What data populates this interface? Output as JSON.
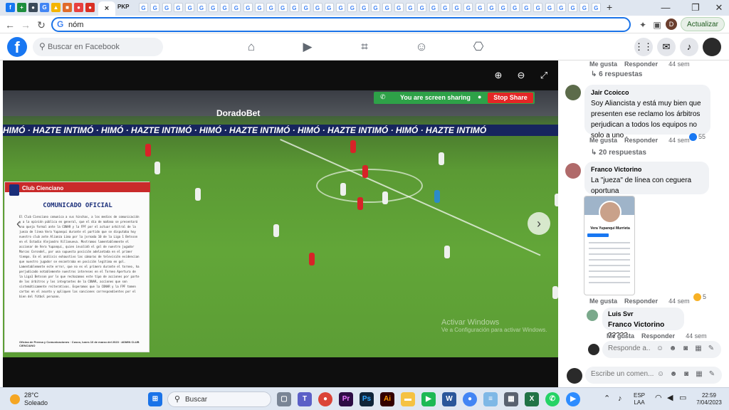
{
  "browser": {
    "tab_favicons": [
      {
        "name": "fb",
        "color": "#1877f2",
        "glyph": "f"
      },
      {
        "name": "sheets",
        "color": "#1e8e3e",
        "glyph": "+"
      },
      {
        "name": "tab3",
        "color": "#3b4a5a",
        "glyph": "●"
      },
      {
        "name": "google",
        "color": "#4285f4",
        "glyph": "G"
      },
      {
        "name": "drive",
        "color": "#f4b400",
        "glyph": "▲"
      },
      {
        "name": "tab6",
        "color": "#e06b2b",
        "glyph": "■"
      },
      {
        "name": "tab7",
        "color": "#e84040",
        "glyph": "●"
      },
      {
        "name": "tab8",
        "color": "#d93025",
        "glyph": "●"
      }
    ],
    "active_tab_close": "×",
    "pkp_label": "PKP",
    "new_tab": "+",
    "window_controls": {
      "minimize": "—",
      "restore": "❐",
      "close": "✕"
    },
    "address_value": "nóm",
    "update_button": "Actualizar",
    "profile_initial": "D"
  },
  "facebook": {
    "search_placeholder": "Buscar en Facebook"
  },
  "video": {
    "banner_text": "HIMÓ · HAZTE INTIMÓ · HIMÓ · HAZTE INTIMÓ · HIMÓ · HAZTE INTIMÓ · HIMÓ · HAZTE INTIMÓ · HIMÓ · HAZTE INTIMÓ",
    "sponsor": "DoradoBet",
    "screen_sharing_text": "You are screen sharing",
    "stop_share_label": "Stop Share",
    "doc_club": "Club Cienciano",
    "doc_title": "COMUNICADO OFICIAL",
    "doc_body": "El Club Cienciano comunica a sus hinchas, a los medios de comunicación y a la opinión pública en general, que el día de mañana se presentará una queja formal ante la CONAR y la FPF por el actuar arbitral de la jueza de línea Vera Yupanqui durante el partido que se disputaba hoy nuestro club ante Alianza Lima por la jornada 10 de la Liga 1 Betsson en el Estadio Alejandro Villanueva. Mostramos lamentablemente el accionar de Vera Yupanqui, quien invalidó el gol de nuestro jugador Marcos Corondel, por una supuesta posición adelantada en el primer tiempo. En el análisis exhaustivo las cámaras de televisión evidencian que nuestro jugador se encontraba en posición legítima en gol. Lamentablemente este error, que no es el primero durante el torneo, ha perjudicado notablemente nuestros intereses en el Torneo Apertura de la Liga1 Betsson por lo que rechazamos este tipo de acciones por parte de los árbitros y los integrantes de la CONAR, acciones que son sistemáticamente reiterativas. Esperamos que la CONAR y la FPF tomen cartas en el asunto y apliquen las sanciones correspondientes por el bien del fútbol peruano.",
    "doc_footer": "Oficina de Prensa y Comunicaciones · Cusco, lunes 10 de marzo del 2023 · ADMIN CLUB CIENCIANO",
    "watermark_title": "Activar Windows",
    "watermark_sub": "Ve a Configuración para activar Windows."
  },
  "comments": {
    "top": {
      "like": "Me gusta",
      "reply": "Responder",
      "time": "44 sem",
      "replies": "6 respuestas"
    },
    "items": [
      {
        "name": "Jair Ccoicco",
        "text": "Soy Aliancista y está muy bien que presenten ese reclamo los árbitros perjudican a todos los equipos no solo a uno .",
        "reactions": "55",
        "like": "Me gusta",
        "reply": "Responder",
        "time": "44 sem",
        "replies": "20 respuestas"
      },
      {
        "name": "Franco Victorino",
        "text": "La \"jueza\" de línea con ceguera oportuna",
        "reactions": "5",
        "like": "Me gusta",
        "reply": "Responder",
        "time": "44 sem"
      },
      {
        "name": "Luis Svr",
        "text_prefix": "Franco Victorino",
        "text": " ?????",
        "like": "Me gusta",
        "reply": "Responder",
        "time": "44 sem"
      }
    ],
    "profile_card_name": "Vera Yupanqui Murrieta",
    "reply_placeholder": "Responde a...",
    "write_placeholder": "Escribe un comen..."
  },
  "taskbar": {
    "weather_temp": "28°C",
    "weather_desc": "Soleado",
    "search_label": "Buscar",
    "lang_line1": "ESP",
    "lang_line2": "LAA",
    "time": "22:59",
    "date": "7/04/2023"
  }
}
